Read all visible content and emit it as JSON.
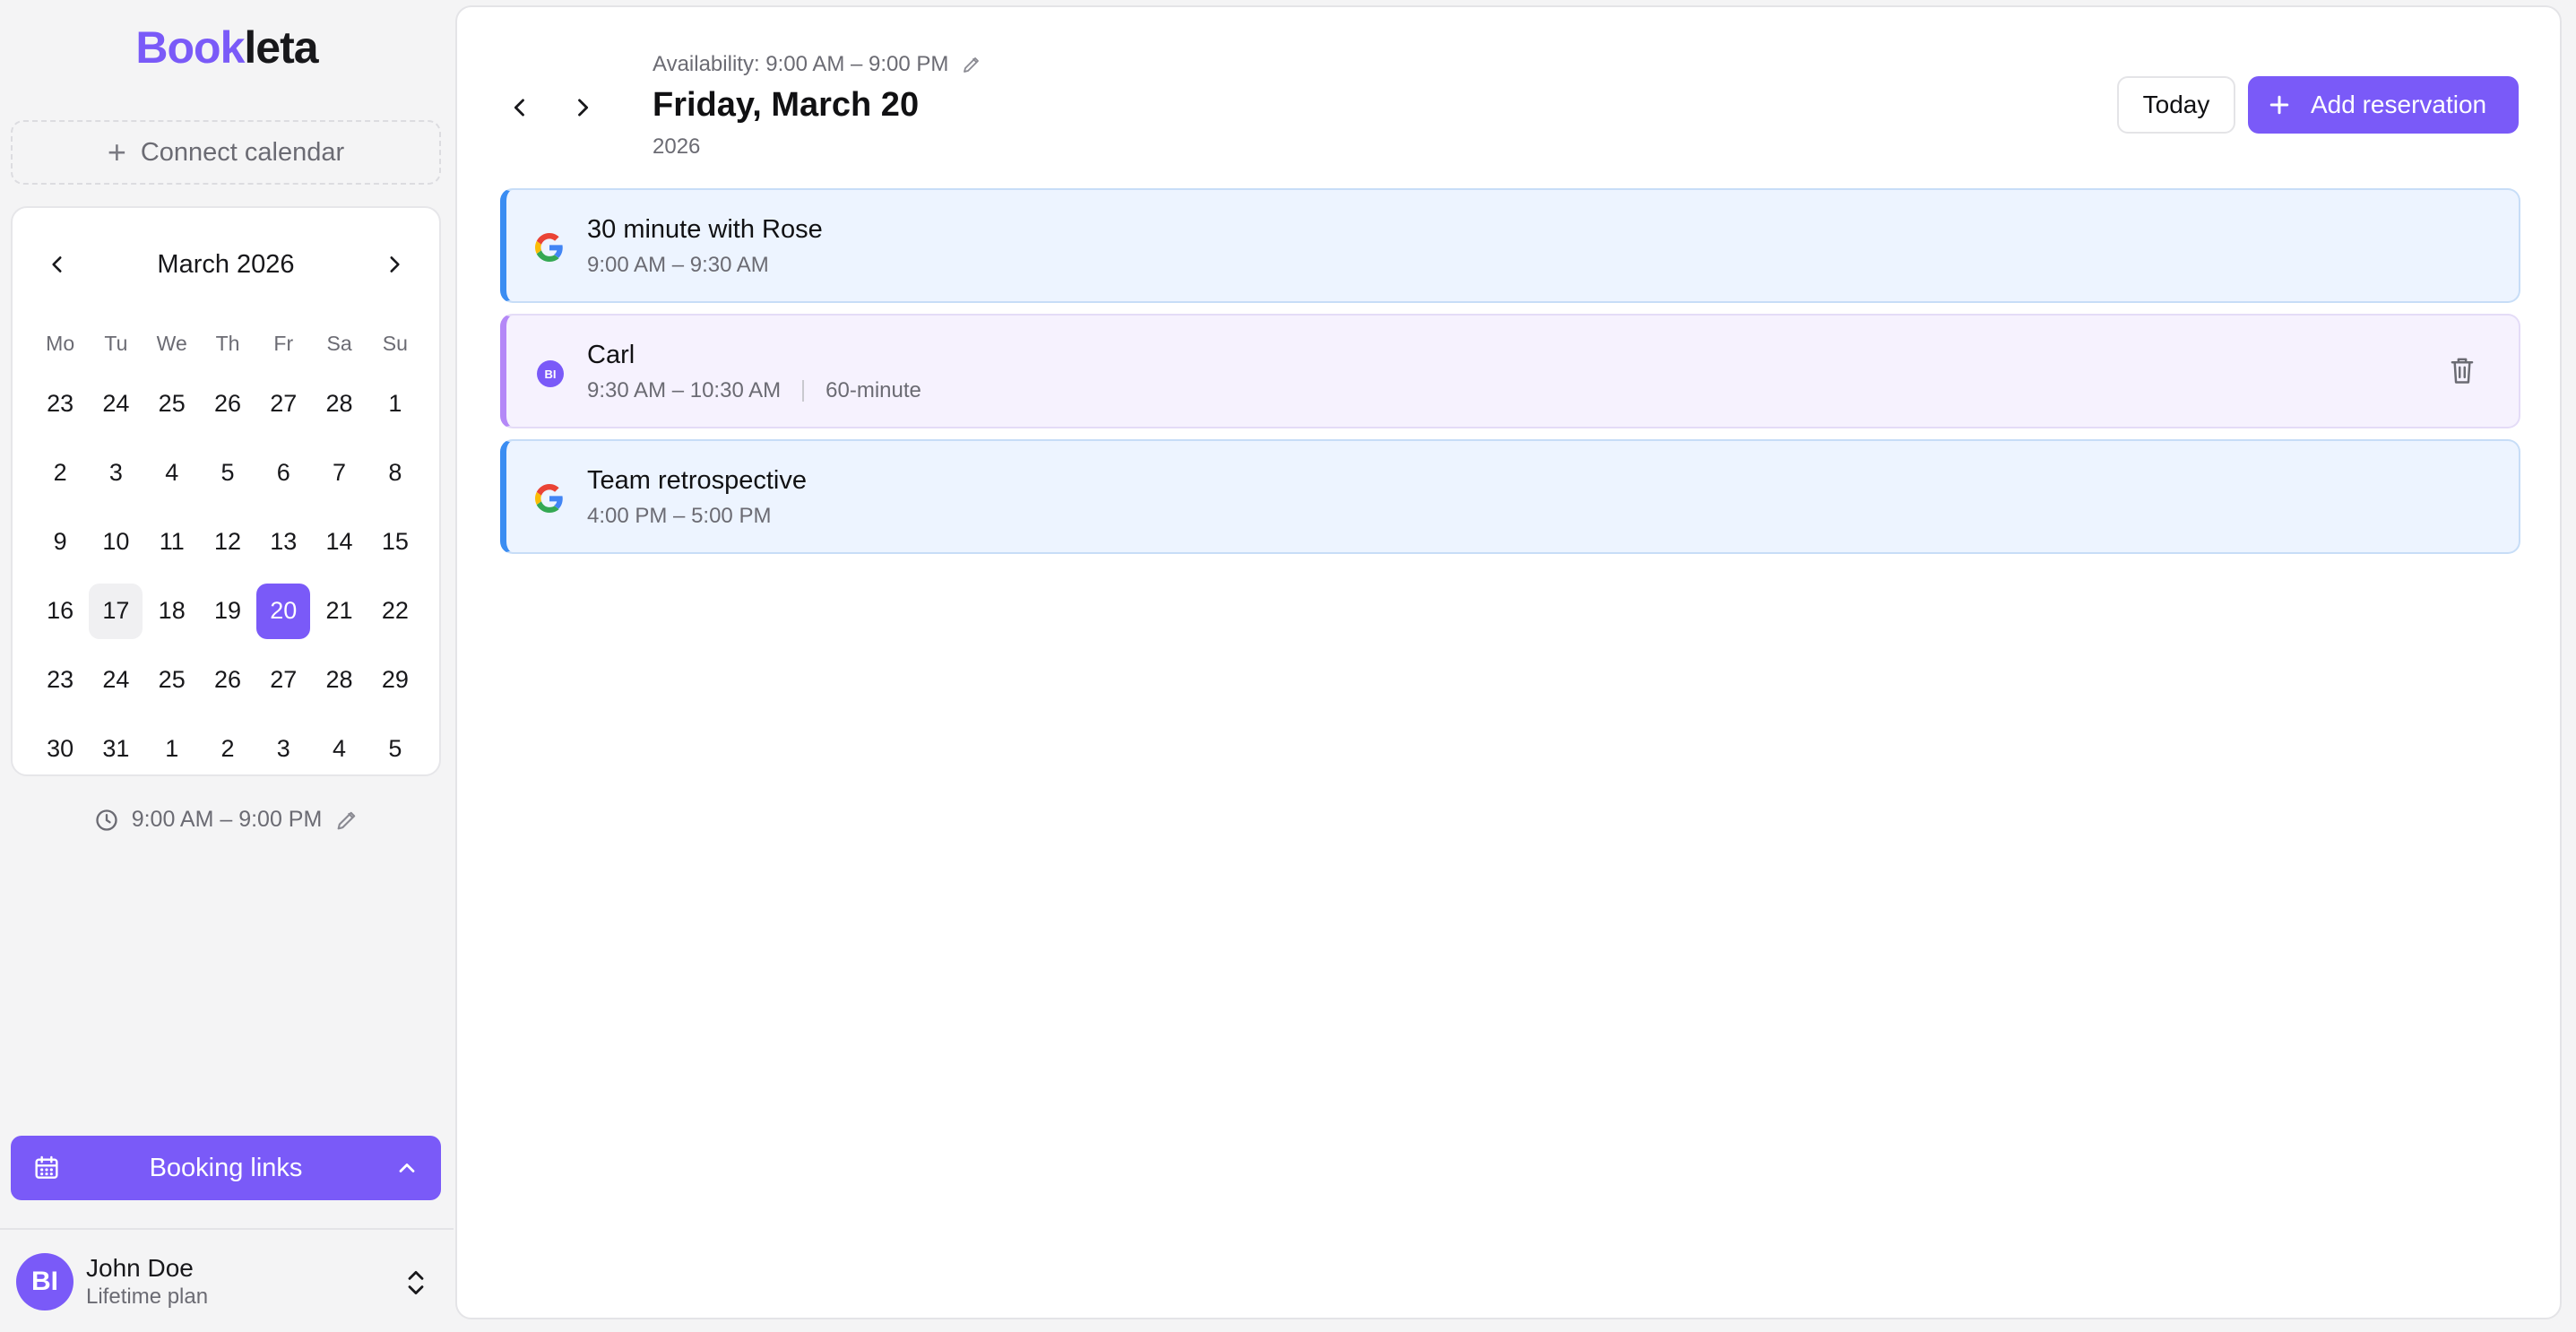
{
  "app": {
    "logo_brand": "Book",
    "logo_rest": "leta"
  },
  "sidebar": {
    "connect_calendar": "Connect calendar",
    "mini_calendar": {
      "title": "March 2026",
      "weekdays": [
        "Mo",
        "Tu",
        "We",
        "Th",
        "Fr",
        "Sa",
        "Su"
      ],
      "weeks": [
        [
          "23",
          "24",
          "25",
          "26",
          "27",
          "28",
          "1"
        ],
        [
          "2",
          "3",
          "4",
          "5",
          "6",
          "7",
          "8"
        ],
        [
          "9",
          "10",
          "11",
          "12",
          "13",
          "14",
          "15"
        ],
        [
          "16",
          "17",
          "18",
          "19",
          "20",
          "21",
          "22"
        ],
        [
          "23",
          "24",
          "25",
          "26",
          "27",
          "28",
          "29"
        ],
        [
          "30",
          "31",
          "1",
          "2",
          "3",
          "4",
          "5"
        ]
      ],
      "today": "17",
      "selected": "20"
    },
    "availability": "9:00 AM – 9:00 PM",
    "booking_links_label": "Booking links",
    "user": {
      "initials": "BI",
      "name": "John Doe",
      "plan": "Lifetime plan"
    }
  },
  "main": {
    "availability": "Availability: 9:00 AM – 9:00 PM",
    "date_title": "Friday, March 20",
    "year": "2026",
    "today_button": "Today",
    "add_button": "Add reservation",
    "events": [
      {
        "title": "30 minute with Rose",
        "time": "9:00 AM – 9:30 AM",
        "source": "google",
        "duration": ""
      },
      {
        "title": "Carl",
        "time": "9:30 AM – 10:30 AM",
        "source": "bookleta",
        "badge": "BI",
        "duration": "60-minute"
      },
      {
        "title": "Team retrospective",
        "time": "4:00 PM – 5:00 PM",
        "source": "google",
        "duration": ""
      }
    ]
  },
  "colors": {
    "accent": "#7a5af8",
    "google_event_border": "#3b8df2",
    "internal_event_border": "#b488f7"
  }
}
